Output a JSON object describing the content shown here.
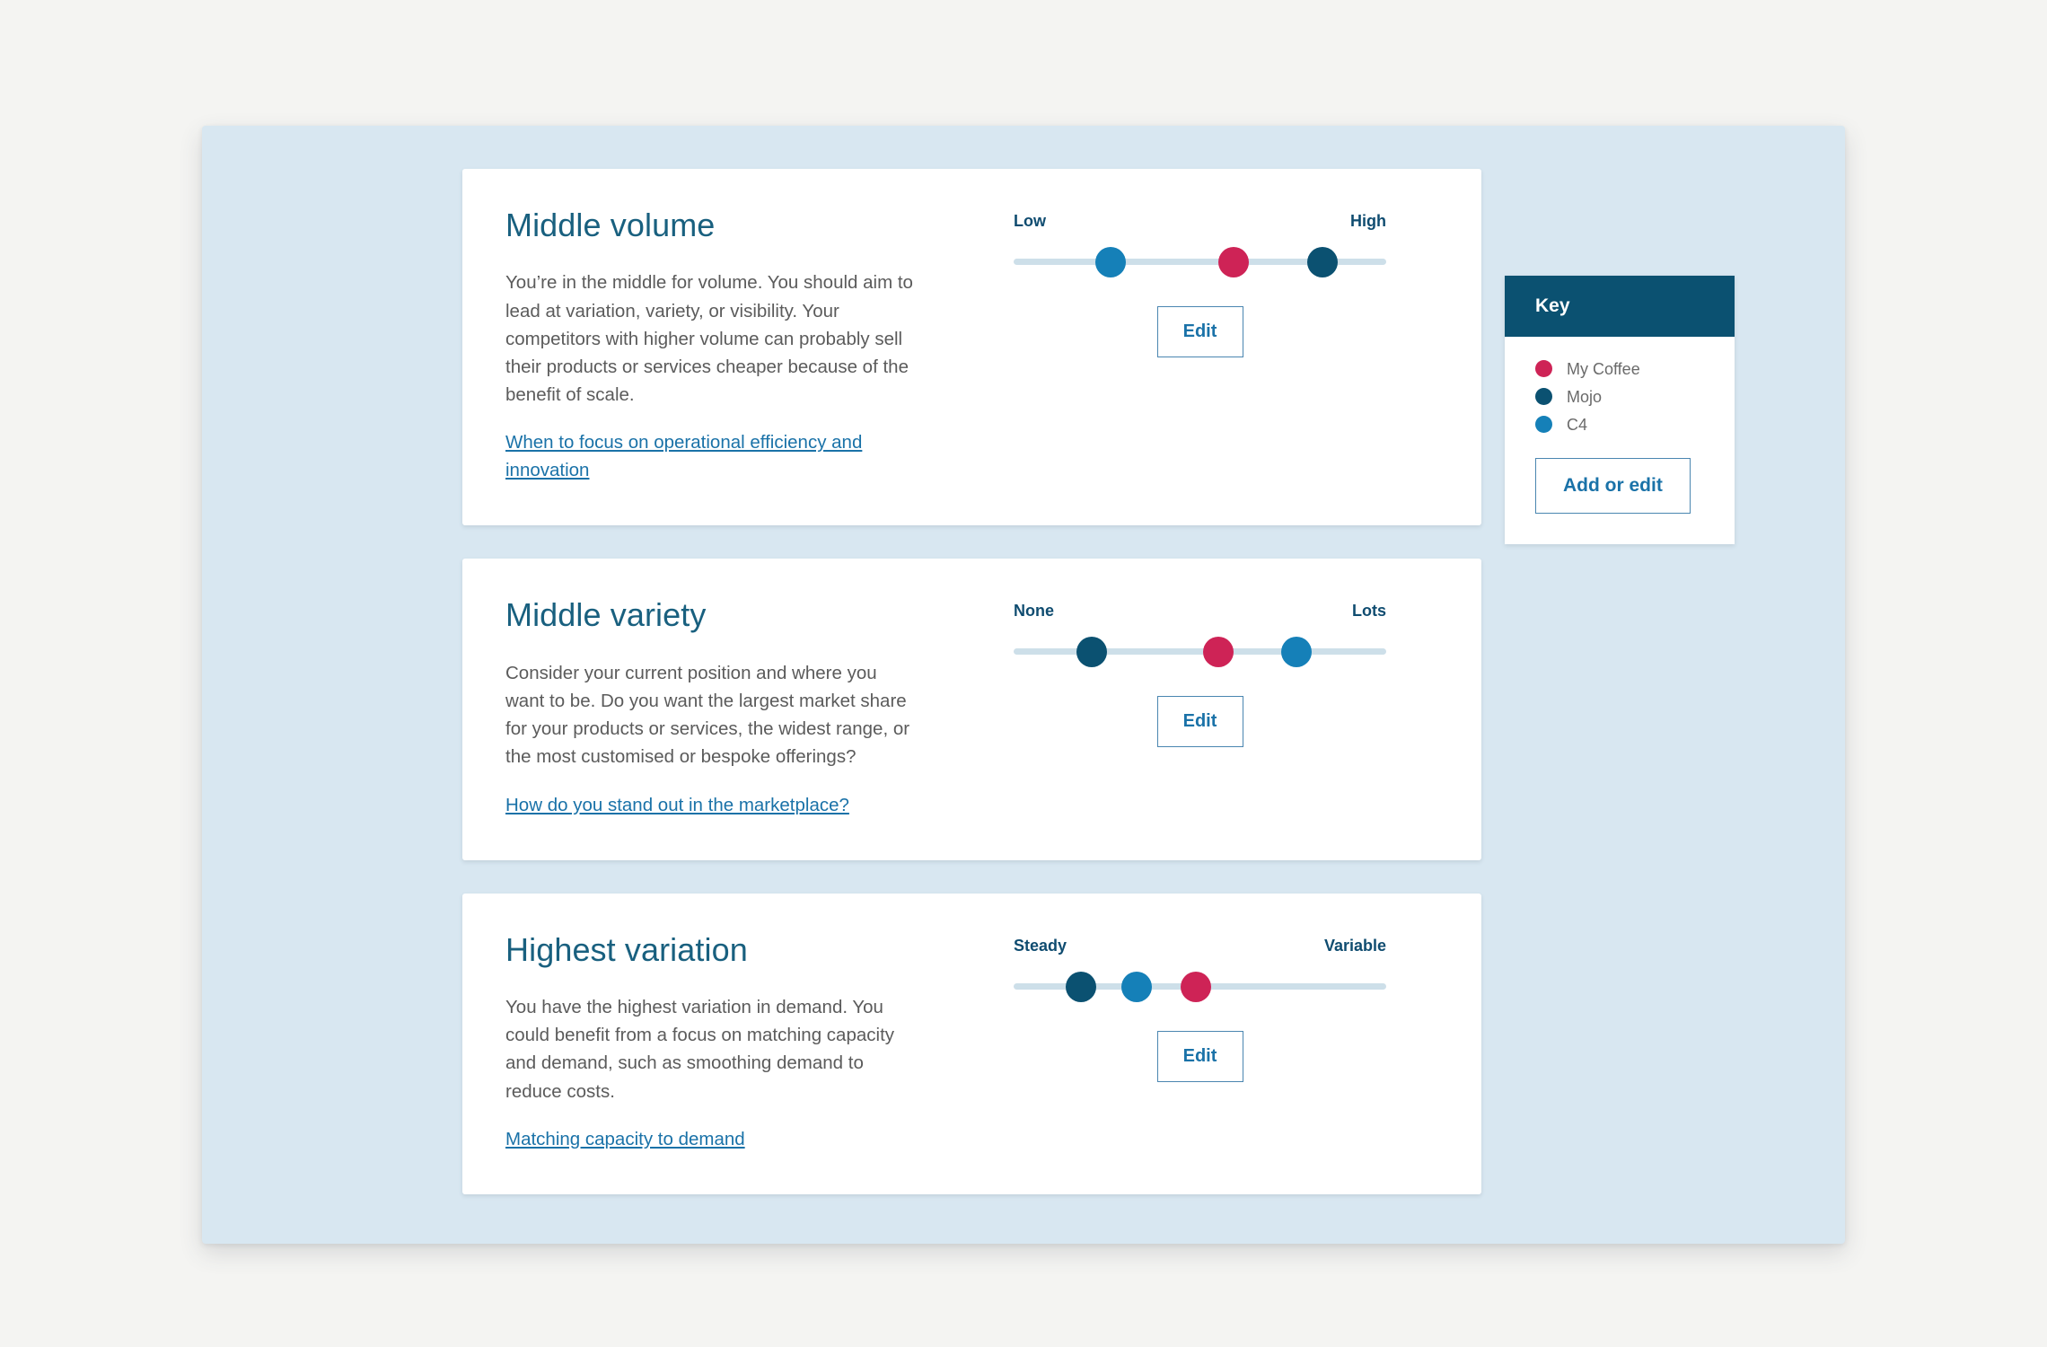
{
  "theme": {
    "page_background": "#f4f4f2",
    "panel_background": "#d8e7f1",
    "card_background": "#ffffff",
    "heading_color": "#19607f",
    "body_text_color": "#5b5b5b",
    "link_color": "#1a72a8",
    "track_color": "#cddfe9",
    "key_header_background": "#0b5171",
    "button_border_color": "#4a86b0"
  },
  "key_panel": {
    "title": "Key",
    "items": [
      {
        "label": "My Coffee",
        "color": "#ce2356"
      },
      {
        "label": "Mojo",
        "color": "#0b5171"
      },
      {
        "label": "C4",
        "color": "#1580b8"
      }
    ],
    "button_label": "Add or edit"
  },
  "cards": [
    {
      "title": "Middle volume",
      "body": "You’re in the middle for volume. You should aim to lead at variation, variety, or visibility. Your competitors with higher volume can probably sell their products or services cheaper because of the benefit of scale.",
      "link": "When to focus on operational efficiency and innovation",
      "edit_label": "Edit",
      "slider": {
        "min_label": "Low",
        "max_label": "High",
        "markers": [
          {
            "name": "C4",
            "color": "#1580b8",
            "position": 26
          },
          {
            "name": "My Coffee",
            "color": "#ce2356",
            "position": 59
          },
          {
            "name": "Mojo",
            "color": "#0b5171",
            "position": 83
          }
        ]
      }
    },
    {
      "title": "Middle variety",
      "body": "Consider your current position and where you want to be. Do you want the largest market share for your products or services, the widest range, or the most customised or bespoke offerings?",
      "link": "How do you stand out in the marketplace?",
      "edit_label": "Edit",
      "slider": {
        "min_label": "None",
        "max_label": "Lots",
        "markers": [
          {
            "name": "Mojo",
            "color": "#0b5171",
            "position": 21
          },
          {
            "name": "My Coffee",
            "color": "#ce2356",
            "position": 55
          },
          {
            "name": "C4",
            "color": "#1580b8",
            "position": 76
          }
        ]
      }
    },
    {
      "title": "Highest variation",
      "body": "You have the highest variation in demand. You could benefit from a focus on matching capacity and demand, such as smoothing demand to reduce costs.",
      "link": "Matching capacity to demand",
      "edit_label": "Edit",
      "slider": {
        "min_label": "Steady",
        "max_label": "Variable",
        "markers": [
          {
            "name": "Mojo",
            "color": "#0b5171",
            "position": 18
          },
          {
            "name": "C4",
            "color": "#1580b8",
            "position": 33
          },
          {
            "name": "My Coffee",
            "color": "#ce2356",
            "position": 49
          }
        ]
      }
    }
  ]
}
